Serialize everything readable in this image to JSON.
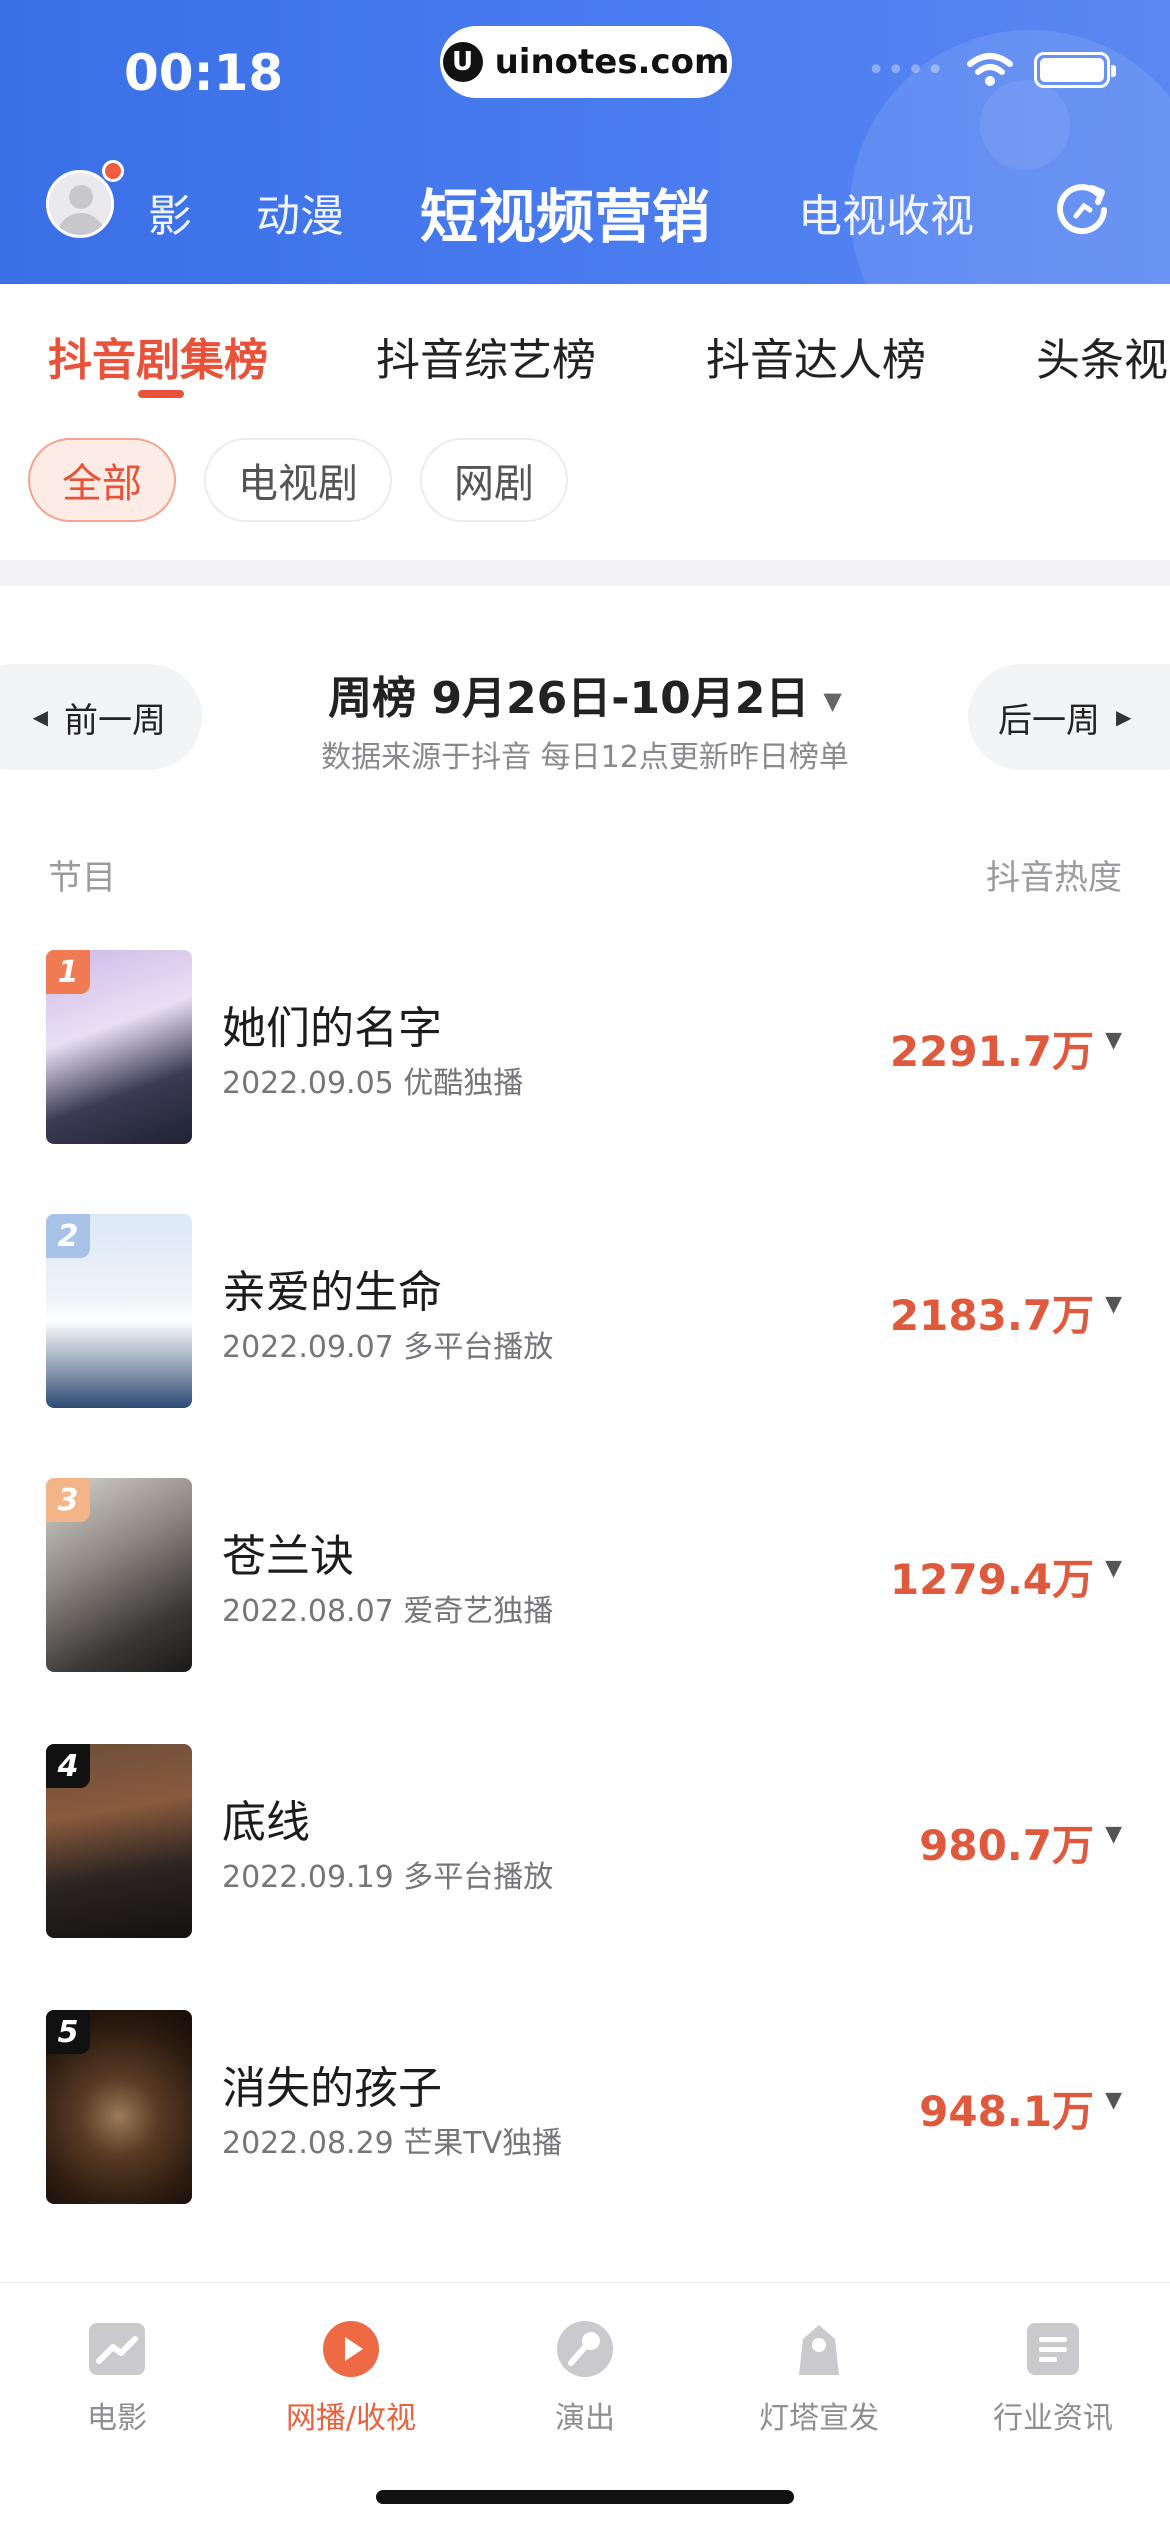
{
  "status": {
    "time": "00:18",
    "url": "uinotes.com"
  },
  "topnav": {
    "items": [
      {
        "label": "影"
      },
      {
        "label": "动漫"
      },
      {
        "label": "短视频营销"
      },
      {
        "label": "电视收视"
      }
    ]
  },
  "tabs": [
    "抖音剧集榜",
    "抖音综艺榜",
    "抖音达人榜",
    "头条视"
  ],
  "chips": [
    "全部",
    "电视剧",
    "网剧"
  ],
  "week": {
    "prev_label": "前一周",
    "next_label": "后一周",
    "title": "周榜 9月26日-10月2日",
    "subtitle": "数据来源于抖音 每日12点更新昨日榜单"
  },
  "columns": {
    "left": "节目",
    "right": "抖音热度"
  },
  "list": [
    {
      "rank": "1",
      "title": "她们的名字",
      "sub": "2022.09.05 优酷独播",
      "heat": "2291.7万",
      "rank_color": "#f07a52"
    },
    {
      "rank": "2",
      "title": "亲爱的生命",
      "sub": "2022.09.07 多平台播放",
      "heat": "2183.7万",
      "rank_color": "#a9c3e8"
    },
    {
      "rank": "3",
      "title": "苍兰诀",
      "sub": "2022.08.07 爱奇艺独播",
      "heat": "1279.4万",
      "rank_color": "#f3b588"
    },
    {
      "rank": "4",
      "title": "底线",
      "sub": "2022.09.19 多平台播放",
      "heat": "980.7万",
      "rank_color": "#111111"
    },
    {
      "rank": "5",
      "title": "消失的孩子",
      "sub": "2022.08.29 芒果TV独播",
      "heat": "948.1万",
      "rank_color": "#111111"
    }
  ],
  "bottom_nav": [
    {
      "label": "电影",
      "icon": "movie-chart-icon"
    },
    {
      "label": "网播/收视",
      "icon": "play-icon"
    },
    {
      "label": "演出",
      "icon": "microphone-icon"
    },
    {
      "label": "灯塔宣发",
      "icon": "lighthouse-icon"
    },
    {
      "label": "行业资讯",
      "icon": "news-icon"
    }
  ],
  "colors": {
    "accent": "#e8523a",
    "header": "#4b7df0"
  }
}
